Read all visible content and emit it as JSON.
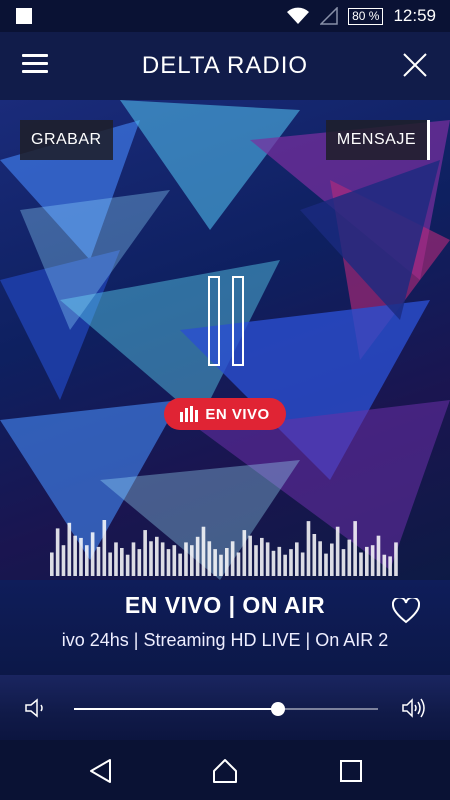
{
  "app": {
    "title": "DELTA RADIO"
  },
  "status_bar": {
    "battery": "80 %",
    "time": "12:59"
  },
  "actions": {
    "record_label": "GRABAR",
    "message_label": "MENSAJE"
  },
  "player": {
    "state": "playing",
    "live_badge": "EN VIVO",
    "status_text": "EN VIVO | ON AIR",
    "marquee_text": "ivo 24hs | Streaming HD LIVE | On AIR 2",
    "favorite": false
  },
  "volume": {
    "level": 0.67
  },
  "visualizer": {
    "levels": [
      0.42,
      0.85,
      0.55,
      0.95,
      0.72,
      0.68,
      0.55,
      0.78,
      0.52,
      1.0,
      0.42,
      0.6,
      0.5,
      0.38,
      0.6,
      0.48,
      0.82,
      0.62,
      0.7,
      0.6,
      0.48,
      0.55,
      0.4,
      0.6,
      0.55,
      0.7,
      0.88,
      0.62,
      0.48,
      0.38,
      0.5,
      0.62,
      0.42,
      0.82,
      0.72,
      0.55,
      0.68,
      0.6,
      0.45,
      0.52,
      0.38,
      0.48,
      0.6,
      0.42,
      0.98,
      0.75,
      0.62,
      0.4,
      0.58,
      0.88,
      0.48,
      0.65,
      0.98,
      0.42,
      0.52,
      0.55,
      0.72,
      0.38,
      0.35,
      0.6
    ]
  },
  "colors": {
    "accent": "#e02434",
    "background": "#0b1438",
    "header": "#111c4a"
  },
  "icons": {
    "menu": "hamburger-icon",
    "close": "close-icon",
    "pause": "pause-icon",
    "live": "signal-bars-icon",
    "favorite": "heart-icon",
    "volume_low": "volume-low-icon",
    "volume_high": "volume-high-icon",
    "back": "back-triangle-icon",
    "home": "home-icon",
    "recents": "recents-square-icon"
  }
}
